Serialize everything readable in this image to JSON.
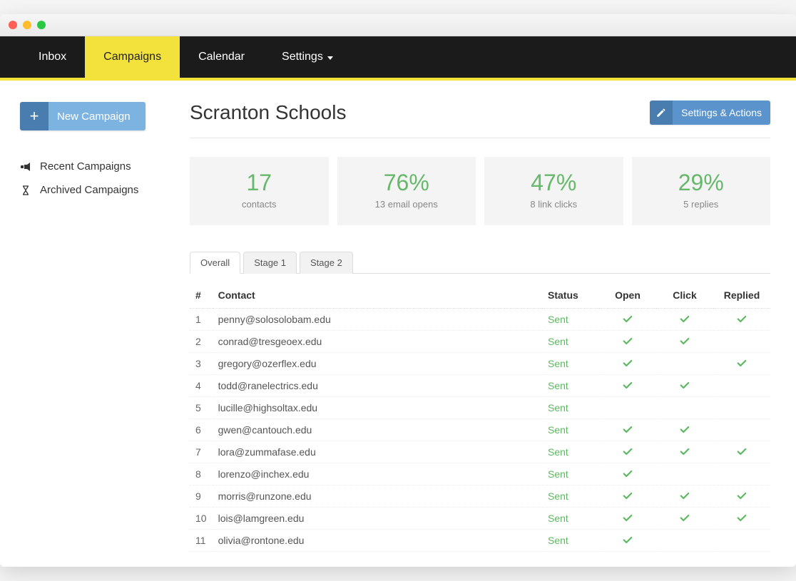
{
  "nav": {
    "items": [
      {
        "label": "Inbox",
        "active": false,
        "dropdown": false
      },
      {
        "label": "Campaigns",
        "active": true,
        "dropdown": false
      },
      {
        "label": "Calendar",
        "active": false,
        "dropdown": false
      },
      {
        "label": "Settings",
        "active": false,
        "dropdown": true
      }
    ]
  },
  "sidebar": {
    "new_campaign_label": "New Campaign",
    "links": [
      {
        "icon": "megaphone-icon",
        "label": "Recent Campaigns"
      },
      {
        "icon": "hourglass-icon",
        "label": "Archived Campaigns"
      }
    ]
  },
  "page": {
    "title": "Scranton Schools",
    "settings_actions_label": "Settings & Actions"
  },
  "stats": [
    {
      "big": "17",
      "sub": "contacts"
    },
    {
      "big": "76%",
      "sub": "13 email opens"
    },
    {
      "big": "47%",
      "sub": "8 link clicks"
    },
    {
      "big": "29%",
      "sub": "5 replies"
    }
  ],
  "subtabs": [
    {
      "label": "Overall",
      "active": true
    },
    {
      "label": "Stage 1",
      "active": false
    },
    {
      "label": "Stage 2",
      "active": false
    }
  ],
  "table": {
    "headers": {
      "num": "#",
      "contact": "Contact",
      "status": "Status",
      "open": "Open",
      "click": "Click",
      "replied": "Replied"
    },
    "rows": [
      {
        "n": "1",
        "contact": "penny@solosolobam.edu",
        "status": "Sent",
        "open": true,
        "click": true,
        "replied": true
      },
      {
        "n": "2",
        "contact": "conrad@tresgeoex.edu",
        "status": "Sent",
        "open": true,
        "click": true,
        "replied": false
      },
      {
        "n": "3",
        "contact": "gregory@ozerflex.edu",
        "status": "Sent",
        "open": true,
        "click": false,
        "replied": true
      },
      {
        "n": "4",
        "contact": "todd@ranelectrics.edu",
        "status": "Sent",
        "open": true,
        "click": true,
        "replied": false
      },
      {
        "n": "5",
        "contact": "lucille@highsoltax.edu",
        "status": "Sent",
        "open": false,
        "click": false,
        "replied": false
      },
      {
        "n": "6",
        "contact": "gwen@cantouch.edu",
        "status": "Sent",
        "open": true,
        "click": true,
        "replied": false
      },
      {
        "n": "7",
        "contact": "lora@zummafase.edu",
        "status": "Sent",
        "open": true,
        "click": true,
        "replied": true
      },
      {
        "n": "8",
        "contact": "lorenzo@inchex.edu",
        "status": "Sent",
        "open": true,
        "click": false,
        "replied": false
      },
      {
        "n": "9",
        "contact": "morris@runzone.edu",
        "status": "Sent",
        "open": true,
        "click": true,
        "replied": true
      },
      {
        "n": "10",
        "contact": "lois@lamgreen.edu",
        "status": "Sent",
        "open": true,
        "click": true,
        "replied": true
      },
      {
        "n": "11",
        "contact": "olivia@rontone.edu",
        "status": "Sent",
        "open": true,
        "click": false,
        "replied": false
      }
    ]
  }
}
